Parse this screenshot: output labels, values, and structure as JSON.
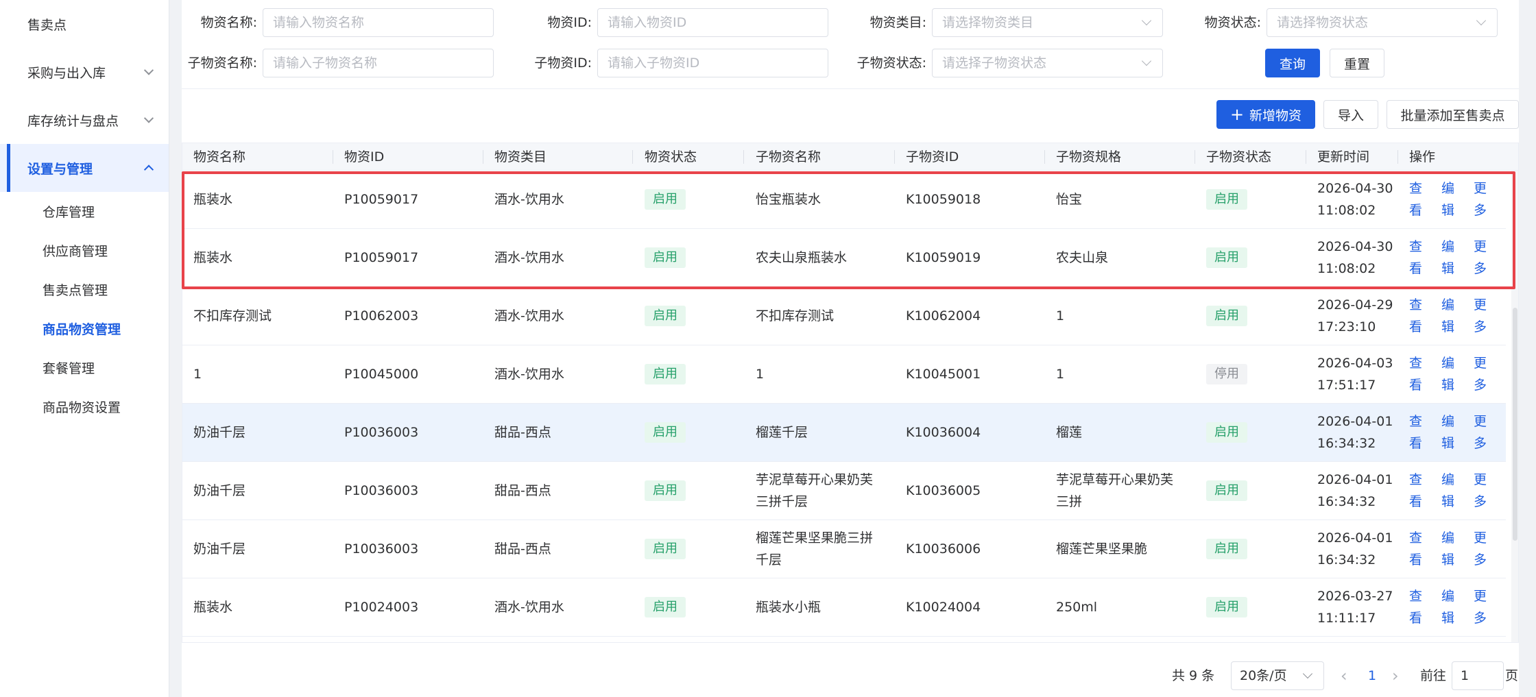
{
  "sidebar": {
    "top_items": [
      {
        "label": "售卖点"
      },
      {
        "label": "采购与出入库"
      },
      {
        "label": "库存统计与盘点"
      },
      {
        "label": "设置与管理"
      }
    ],
    "sub_items": [
      {
        "label": "仓库管理"
      },
      {
        "label": "供应商管理"
      },
      {
        "label": "售卖点管理"
      },
      {
        "label": "商品物资管理"
      },
      {
        "label": "套餐管理"
      },
      {
        "label": "商品物资设置"
      }
    ]
  },
  "filters": {
    "item_name": {
      "label": "物资名称:",
      "placeholder": "请输入物资名称"
    },
    "item_id": {
      "label": "物资ID:",
      "placeholder": "请输入物资ID"
    },
    "category": {
      "label": "物资类目:",
      "placeholder": "请选择物资类目"
    },
    "status": {
      "label": "物资状态:",
      "placeholder": "请选择物资状态"
    },
    "sub_name": {
      "label": "子物资名称:",
      "placeholder": "请输入子物资名称"
    },
    "sub_id": {
      "label": "子物资ID:",
      "placeholder": "请输入子物资ID"
    },
    "sub_status": {
      "label": "子物资状态:",
      "placeholder": "请选择子物资状态"
    },
    "query_label": "查询",
    "reset_label": "重置"
  },
  "toolbar": {
    "add_label": "新增物资",
    "import_label": "导入",
    "batch_label": "批量添加至售卖点"
  },
  "table": {
    "headers": [
      "物资名称",
      "物资ID",
      "物资类目",
      "物资状态",
      "子物资名称",
      "子物资ID",
      "子物资规格",
      "子物资状态",
      "更新时间",
      "操作"
    ],
    "actions": {
      "view": "查看",
      "edit": "编辑",
      "more": "更多"
    },
    "rows": [
      {
        "name": "瓶装水",
        "id": "P10059017",
        "category": "酒水-饮用水",
        "status": "启用",
        "sub_name": "怡宝瓶装水",
        "sub_id": "K10059018",
        "spec": "怡宝",
        "sub_status": "启用",
        "date": "2026-04-30",
        "time": "11:08:02"
      },
      {
        "name": "瓶装水",
        "id": "P10059017",
        "category": "酒水-饮用水",
        "status": "启用",
        "sub_name": "农夫山泉瓶装水",
        "sub_id": "K10059019",
        "spec": "农夫山泉",
        "sub_status": "启用",
        "date": "2026-04-30",
        "time": "11:08:02"
      },
      {
        "name": "不扣库存测试",
        "id": "P10062003",
        "category": "酒水-饮用水",
        "status": "启用",
        "sub_name": "不扣库存测试",
        "sub_id": "K10062004",
        "spec": "1",
        "sub_status": "启用",
        "date": "2026-04-29",
        "time": "17:23:10"
      },
      {
        "name": "1",
        "id": "P10045000",
        "category": "酒水-饮用水",
        "status": "启用",
        "sub_name": "1",
        "sub_id": "K10045001",
        "spec": "1",
        "sub_status": "停用",
        "date": "2026-04-03",
        "time": "17:51:17"
      },
      {
        "name": "奶油千层",
        "id": "P10036003",
        "category": "甜品-西点",
        "status": "启用",
        "sub_name": "榴莲千层",
        "sub_id": "K10036004",
        "spec": "榴莲",
        "sub_status": "启用",
        "date": "2026-04-01",
        "time": "16:34:32"
      },
      {
        "name": "奶油千层",
        "id": "P10036003",
        "category": "甜品-西点",
        "status": "启用",
        "sub_name": "芋泥草莓开心果奶芙三拼千层",
        "sub_id": "K10036005",
        "spec": "芋泥草莓开心果奶芙三拼",
        "sub_status": "启用",
        "date": "2026-04-01",
        "time": "16:34:32"
      },
      {
        "name": "奶油千层",
        "id": "P10036003",
        "category": "甜品-西点",
        "status": "启用",
        "sub_name": "榴莲芒果坚果脆三拼千层",
        "sub_id": "K10036006",
        "spec": "榴莲芒果坚果脆",
        "sub_status": "启用",
        "date": "2026-04-01",
        "time": "16:34:32"
      },
      {
        "name": "瓶装水",
        "id": "P10024003",
        "category": "酒水-饮用水",
        "status": "启用",
        "sub_name": "瓶装水小瓶",
        "sub_id": "K10024004",
        "spec": "250ml",
        "sub_status": "启用",
        "date": "2026-03-27",
        "time": "11:11:17"
      }
    ]
  },
  "pagination": {
    "total": "共 9 条",
    "page_size": "20条/页",
    "current": "1",
    "goto_prefix": "前往",
    "goto_value": "1",
    "goto_suffix": "页"
  },
  "colors": {
    "primary": "#1f5fe0",
    "enabled": "#26a06a",
    "highlight_box": "#e8434a"
  }
}
